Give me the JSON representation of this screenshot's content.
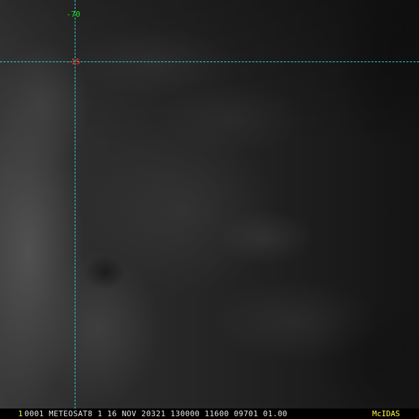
{
  "viewer": {
    "background_color": "#1b1b1b",
    "imagery": "infrared satellite image, dark gray field with lighter cloud texture on the left"
  },
  "grid": {
    "line_color": "#2fd6d6",
    "longitude_label": "-70",
    "longitude_label_color": "#20e020",
    "latitude_label": "-15",
    "latitude_label_color": "#ff3030"
  },
  "status_bar": {
    "frame_number": "1",
    "frame_number_color": "#ffff40",
    "header_text": "0001 METEOSAT8   1 16 NOV 20321 130000 11600 09701 01.00",
    "header_color": "#e8e8e8",
    "brand": "McIDAS",
    "brand_color": "#ffff40"
  }
}
